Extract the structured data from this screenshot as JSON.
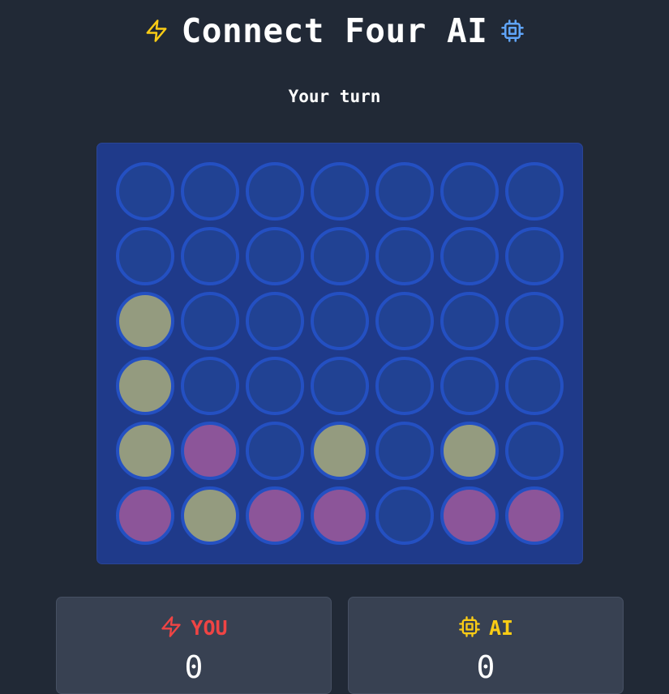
{
  "header": {
    "title": "Connect Four AI",
    "left_icon": "lightning-icon",
    "right_icon": "cpu-chip-icon",
    "left_icon_color": "#facc15",
    "right_icon_color": "#60a5fa"
  },
  "status": {
    "text": "Your turn"
  },
  "board": {
    "columns": 7,
    "rows": 6,
    "board_color": "#1f3a8a",
    "empty_color": "#214293",
    "player_color": "#949b7f",
    "ai_color": "#8c5599",
    "cells": [
      [
        0,
        0,
        0,
        0,
        0,
        0,
        0
      ],
      [
        0,
        0,
        0,
        0,
        0,
        0,
        0
      ],
      [
        1,
        0,
        0,
        0,
        0,
        0,
        0
      ],
      [
        1,
        0,
        0,
        0,
        0,
        0,
        0
      ],
      [
        1,
        2,
        0,
        1,
        0,
        1,
        0
      ],
      [
        2,
        1,
        2,
        2,
        0,
        2,
        2
      ]
    ]
  },
  "scores": {
    "player": {
      "label": "YOU",
      "value": "0",
      "icon": "lightning-icon",
      "color": "#ef4444"
    },
    "ai": {
      "label": "AI",
      "value": "0",
      "icon": "cpu-chip-icon",
      "color": "#facc15"
    }
  }
}
